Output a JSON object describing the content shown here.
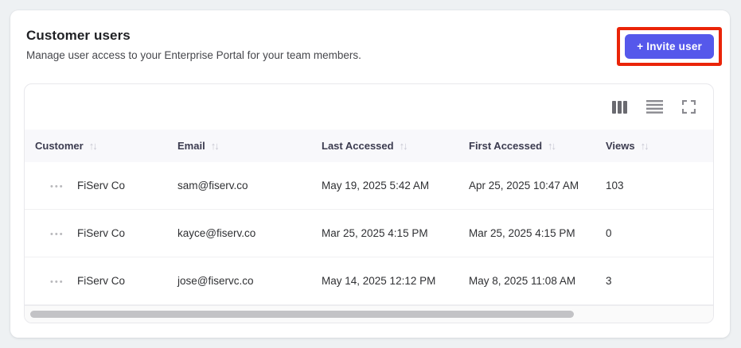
{
  "panel": {
    "title": "Customer users",
    "subtitle": "Manage user access to your Enterprise Portal for your team members.",
    "invite_button_label": "+ Invite user",
    "accent_colors": {
      "button": "#5558eb",
      "annotation_highlight": "#ea2408"
    }
  },
  "toolbar": {
    "icons": [
      {
        "name": "columns-icon"
      },
      {
        "name": "row-density-icon"
      },
      {
        "name": "fullscreen-icon"
      }
    ]
  },
  "icons": {
    "sort_glyph": "↑↓",
    "drag_handle_glyph": "•••"
  },
  "table": {
    "columns": [
      {
        "label": "Customer",
        "sortable": true
      },
      {
        "label": "Email",
        "sortable": true
      },
      {
        "label": "Last Accessed",
        "sortable": true
      },
      {
        "label": "First Accessed",
        "sortable": true
      },
      {
        "label": "Views",
        "sortable": true
      }
    ],
    "rows": [
      {
        "customer": "FiServ Co",
        "email": "sam@fiserv.co",
        "last_accessed": "May 19, 2025 5:42 AM",
        "first_accessed": "Apr 25, 2025 10:47 AM",
        "views": "103"
      },
      {
        "customer": "FiServ Co",
        "email": "kayce@fiserv.co",
        "last_accessed": "Mar 25, 2025 4:15 PM",
        "first_accessed": "Mar 25, 2025 4:15 PM",
        "views": "0"
      },
      {
        "customer": "FiServ Co",
        "email": "jose@fiservc.co",
        "last_accessed": "May 14, 2025 12:12 PM",
        "first_accessed": "May 8, 2025 11:08 AM",
        "views": "3"
      }
    ]
  }
}
